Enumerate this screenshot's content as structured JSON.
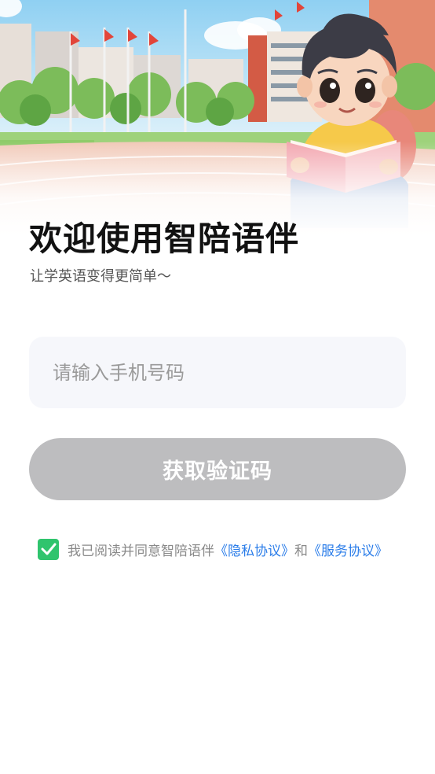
{
  "hero": {
    "icon": "school-boy-reading-illustration"
  },
  "login": {
    "title": "欢迎使用智陪语伴",
    "subtitle": "让学英语变得更简单～",
    "phone_placeholder": "请输入手机号码",
    "get_code_label": "获取验证码",
    "button_color": "#bdbdbf"
  },
  "agreement": {
    "checked": true,
    "check_color": "#2fc46d",
    "prefix": "我已阅读并同意智陪语伴",
    "privacy_link": "《隐私协议》",
    "conjunction": "和",
    "service_link": "《服务协议》",
    "link_color": "#2b7de9"
  }
}
